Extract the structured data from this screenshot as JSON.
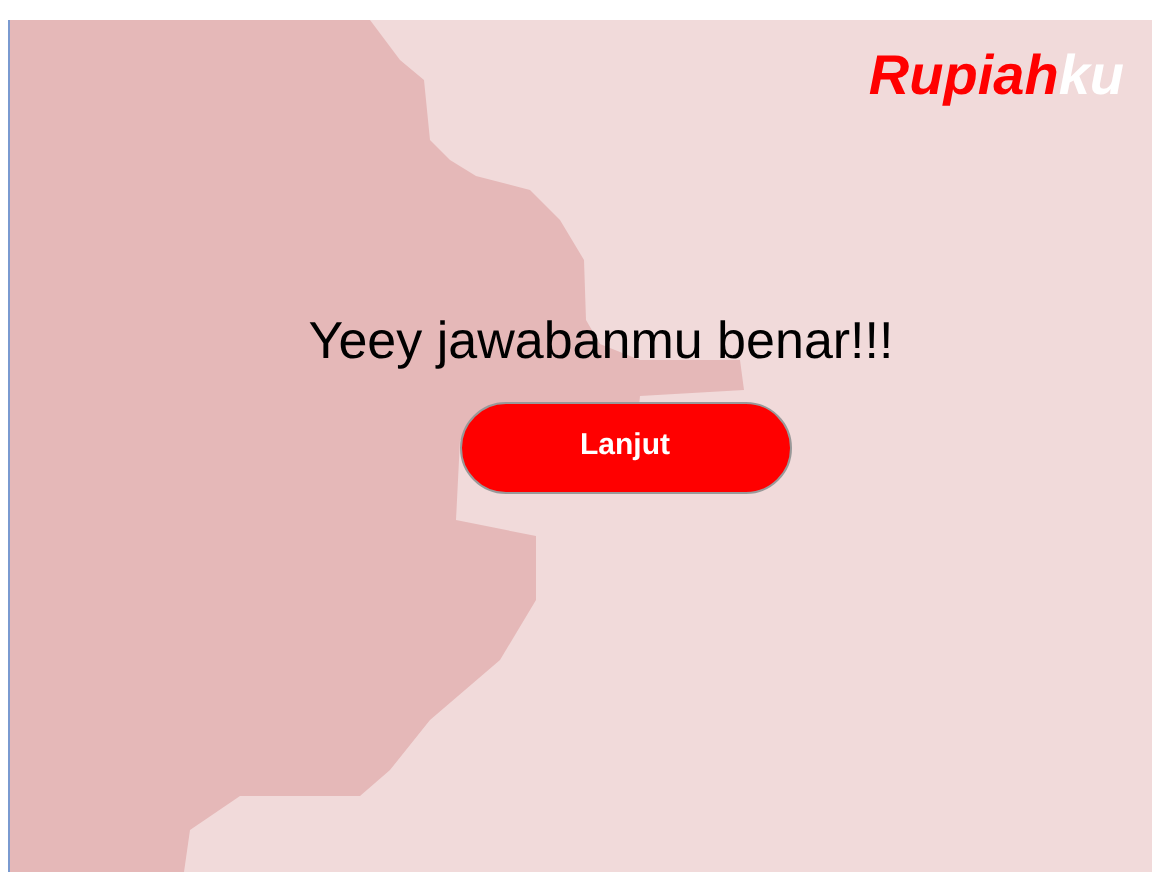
{
  "logo": {
    "primary": "Rupiah",
    "accent": "ku"
  },
  "message": "Yeey jawabanmu benar!!!",
  "button": {
    "label": "Lanjut"
  }
}
